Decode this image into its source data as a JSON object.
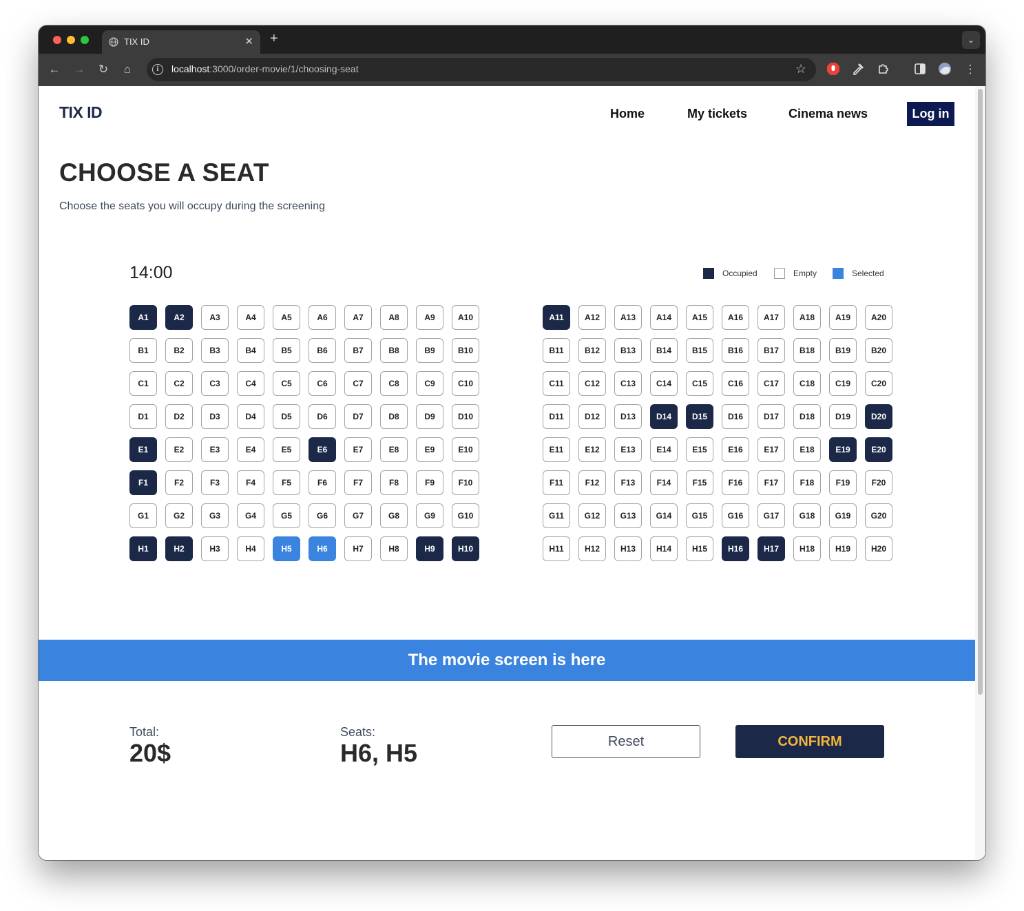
{
  "browser": {
    "tab_title": "TIX ID",
    "tab_close_glyph": "✕",
    "new_tab_glyph": "+",
    "tab_menu_glyph": "⌄",
    "url_host": "localhost",
    "url_path": ":3000/order-movie/1/choosing-seat",
    "info_glyph": "i",
    "star_glyph": "☆",
    "back_glyph": "←",
    "forward_glyph": "→",
    "reload_glyph": "↻",
    "home_glyph": "⌂",
    "menu_glyph": "⋮"
  },
  "header": {
    "logo_main": "TIX",
    "logo_suffix": " ID",
    "nav": [
      "Home",
      "My tickets",
      "Cinema news"
    ],
    "login_label": "Log in"
  },
  "page": {
    "title": "CHOOSE A SEAT",
    "subtitle": "Choose the seats you will occupy during the screening"
  },
  "seating": {
    "showtime": "14:00",
    "legend": [
      {
        "label": "Occupied",
        "status": "occupied"
      },
      {
        "label": "Empty",
        "status": "empty"
      },
      {
        "label": "Selected",
        "status": "selected"
      }
    ],
    "rows": [
      "A",
      "B",
      "C",
      "D",
      "E",
      "F",
      "G",
      "H"
    ],
    "columns": 20,
    "occupied": [
      "A1",
      "A2",
      "A11",
      "D14",
      "D15",
      "D20",
      "E1",
      "E6",
      "E19",
      "E20",
      "F1",
      "H1",
      "H2",
      "H9",
      "H10",
      "H16",
      "H17"
    ],
    "selected": [
      "H5",
      "H6"
    ]
  },
  "screen_label": "The movie screen is here",
  "summary": {
    "total_label": "Total:",
    "total_value": "20$",
    "seats_label": "Seats:",
    "seats_value": "H6, H5",
    "reset_label": "Reset",
    "confirm_label": "CONFIRM"
  },
  "colors": {
    "occupied": "#1c2848",
    "selected": "#3a84e0",
    "confirm_text": "#f2b63c",
    "login_bg": "#0d1a52"
  }
}
